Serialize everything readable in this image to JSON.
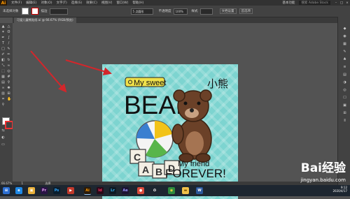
{
  "menubar": {
    "logo": "Ai",
    "items": [
      "文件(F)",
      "编辑(E)",
      "对象(O)",
      "文字(T)",
      "选择(S)",
      "效果(C)",
      "视图(V)",
      "窗口(W)",
      "帮助(H)"
    ],
    "workspace": "基本功能",
    "search_placeholder": "搜索 Adobe Stock"
  },
  "ctrlbar": {
    "selection_label": "未选择对象",
    "stroke_label": "描边",
    "brush_value": "5 点圆形",
    "opacity_label": "不透明度",
    "opacity_value": "100%",
    "style_label": "样式",
    "doc_settings": "文档设置",
    "prefs": "首选项"
  },
  "document": {
    "tab_title": "可爱儿童熊贴纸.ai @ 66.67% (RGB/预览)"
  },
  "artwork": {
    "line1": "My sweet",
    "line2": "BEAR",
    "chinese": "小熊",
    "line3": "My friend",
    "line4": "FOREVER!",
    "block_a": "A",
    "block_b": "B",
    "block_c": "C",
    "block_d": "D",
    "colors": {
      "bg": "#7dd4d0",
      "bear": "#6b4128",
      "label": "#f0e14a"
    }
  },
  "statusbar": {
    "zoom": "66.67%",
    "page": "1",
    "tool": "选择"
  },
  "taskbar": {
    "apps": [
      "start",
      "browser",
      "files",
      "Pr",
      "Ps",
      "video",
      "Ai",
      "Id",
      "Lr",
      "Ae",
      "game",
      "qq",
      "chrome",
      "folder",
      "word"
    ],
    "time": "9:12",
    "date": "2020/4/17"
  },
  "watermark": {
    "brand": "Bai经验",
    "url": "jingyan.baidu.com"
  }
}
